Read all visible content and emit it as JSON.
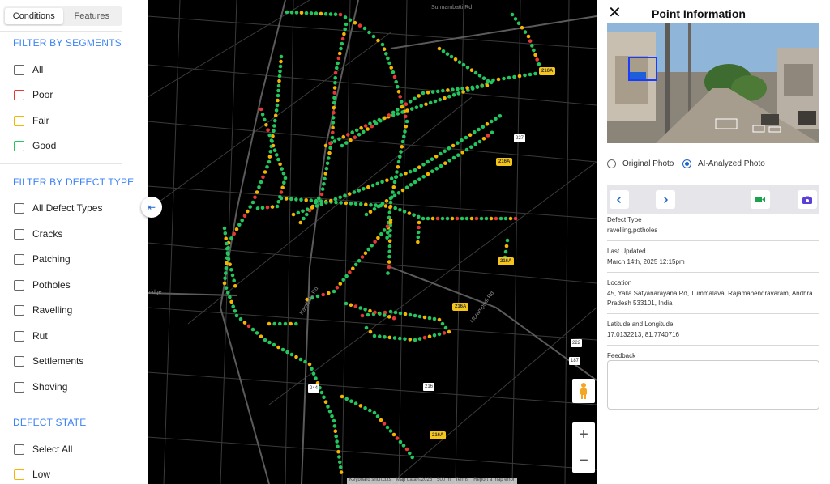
{
  "tabs": [
    {
      "label": "Conditions",
      "active": true
    },
    {
      "label": "Features",
      "active": false
    }
  ],
  "segments": {
    "title": "FILTER BY SEGMENTS",
    "items": [
      {
        "label": "All",
        "color": "#666666"
      },
      {
        "label": "Poor",
        "color": "#e53935"
      },
      {
        "label": "Fair",
        "color": "#f5b400"
      },
      {
        "label": "Good",
        "color": "#22c55e"
      }
    ]
  },
  "defect_types": {
    "title": "FILTER BY DEFECT TYPE",
    "items": [
      "All Defect Types",
      "Cracks",
      "Patching",
      "Potholes",
      "Ravelling",
      "Rut",
      "Settlements",
      "Shoving"
    ]
  },
  "defect_state": {
    "title": "DEFECT STATE",
    "items": [
      {
        "label": "Select All",
        "color": "#666666"
      },
      {
        "label": "Low",
        "color": "#f5b400"
      }
    ]
  },
  "map": {
    "road_labels": [
      "Sunnambatti Rd",
      "ridge",
      "Kambala Rd",
      "Morampudi Rd"
    ],
    "route_shields": [
      "216A",
      "216A",
      "216A",
      "216A",
      "216A"
    ],
    "nh_shields": [
      "227",
      "222",
      "187",
      "244",
      "216"
    ],
    "attribution": [
      "Keyboard shortcuts",
      "Map data ©2025",
      "500 m",
      "Terms",
      "Report a map error"
    ],
    "zoom_in": "+",
    "zoom_out": "−",
    "collapse_icon": "⇤",
    "colors": {
      "poor": "#e53935",
      "fair": "#f5b400",
      "good": "#22c55e"
    }
  },
  "info": {
    "title": "Point Information",
    "close": "✕",
    "photo_options": [
      {
        "label": "Original Photo",
        "selected": false
      },
      {
        "label": "AI-Analyzed Photo",
        "selected": true
      }
    ],
    "fields": [
      {
        "label": "Defect Type",
        "value": "ravelling,potholes"
      },
      {
        "label": "Last Updated",
        "value": "March 14th, 2025 12:15pm"
      },
      {
        "label": "Location",
        "value": "45, Yalla Satyanarayana Rd, Tummalava, Rajamahendravaram, Andhra Pradesh 533101, India"
      },
      {
        "label": "Latitude and Longitude",
        "value": "17.0132213, 81.7740716"
      },
      {
        "label": "Feedback",
        "value": ""
      }
    ],
    "accent": "#1e62c9"
  }
}
